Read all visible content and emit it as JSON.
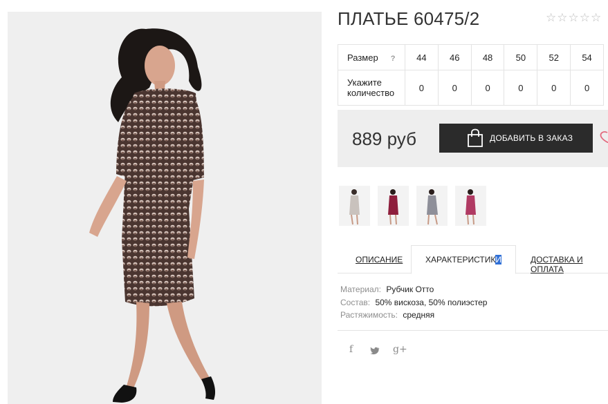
{
  "product": {
    "title": "ПЛАТЬЕ 60475/2",
    "rating": {
      "filled": 0,
      "max": 5
    }
  },
  "sizes_table": {
    "size_label": "Размер",
    "help": "?",
    "sizes": [
      "44",
      "46",
      "48",
      "50",
      "52",
      "54"
    ],
    "qty_label": "Укажите количество",
    "quantities": [
      "0",
      "0",
      "0",
      "0",
      "0",
      "0"
    ]
  },
  "purchase": {
    "price": "889 руб",
    "add_button": "ДОБАВИТЬ В ЗАКАЗ"
  },
  "thumbnails": [
    {
      "name": "light-grey-dress",
      "color": "#c9c2bd"
    },
    {
      "name": "burgundy-dress",
      "color": "#8e1f3d"
    },
    {
      "name": "grey-pattern-dress",
      "color": "#8e8f99"
    },
    {
      "name": "pink-pattern-dress",
      "color": "#b03a63"
    }
  ],
  "tabs": {
    "description": "ОПИСАНИЕ",
    "characteristics_main": "ХАРАКТЕРИСТИК",
    "characteristics_selected": "И",
    "delivery": "ДОСТАВКА И ОПЛАТА"
  },
  "characteristics": [
    {
      "key": "Материал:",
      "value": "Рубчик Отто"
    },
    {
      "key": "Состав:",
      "value": "50% вискоза, 50% полиэстер"
    },
    {
      "key": "Растяжимость:",
      "value": "средняя"
    }
  ],
  "social": {
    "facebook": "f",
    "twitter": "twitter-bird-icon",
    "google_plus": "g+"
  },
  "colors": {
    "button": "#2b2b2b",
    "price_bg": "#eeeeee",
    "selection": "#2f6fd6",
    "heart": "#e26a7e"
  }
}
